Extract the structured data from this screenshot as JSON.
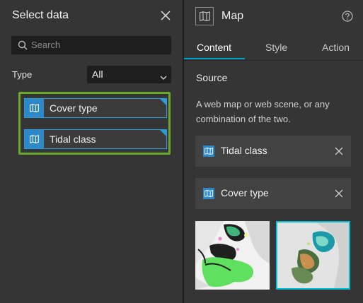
{
  "left_panel": {
    "title": "Select data",
    "search": {
      "placeholder": "Search",
      "value": ""
    },
    "type_label": "Type",
    "type_select": {
      "value": "All"
    },
    "items": [
      {
        "label": "Cover type"
      },
      {
        "label": "Tidal class"
      }
    ]
  },
  "right_panel": {
    "title": "Map",
    "tabs": [
      {
        "label": "Content",
        "active": true
      },
      {
        "label": "Style",
        "active": false
      },
      {
        "label": "Action",
        "active": false
      }
    ],
    "source_heading": "Source",
    "source_description": "A web map or web scene, or any combination of the two.",
    "sources": [
      {
        "label": "Tidal class"
      },
      {
        "label": "Cover type"
      }
    ]
  },
  "colors": {
    "accent_blue": "#2d88c8",
    "selection_green": "#6aa82b",
    "tab_underline": "#00a3c7",
    "panel_bg": "#353535"
  }
}
